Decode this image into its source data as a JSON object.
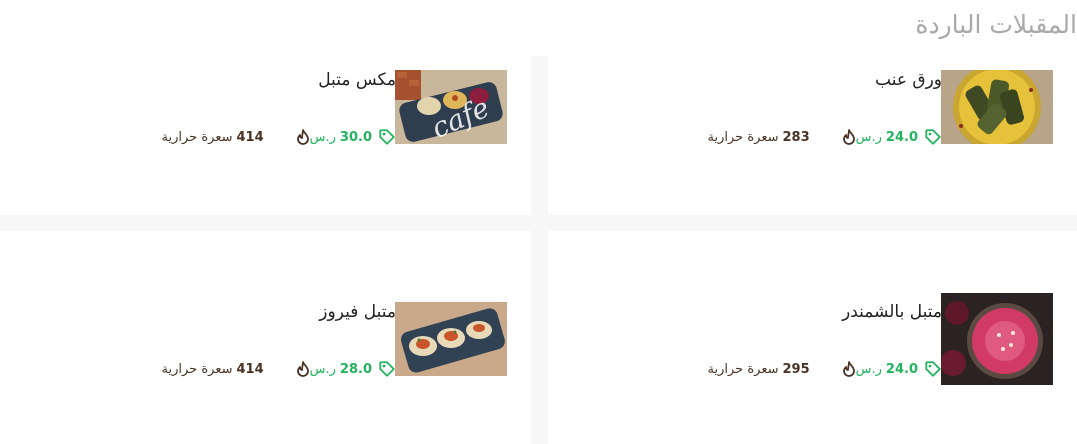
{
  "section": {
    "title": "المقبلات الباردة"
  },
  "items": [
    {
      "name": "ورق عنب",
      "price": "24.0",
      "currency": "ر.س",
      "calories": "283",
      "calories_label": "سعرة حرارية",
      "image": "stuffed-grape-leaves"
    },
    {
      "name": "مكس متبل",
      "price": "30.0",
      "currency": "ر.س",
      "calories": "414",
      "calories_label": "سعرة حرارية",
      "image": "mutabal-mix"
    },
    {
      "name": "متبل بالشمندر",
      "price": "24.0",
      "currency": "ر.س",
      "calories": "295",
      "calories_label": "سعرة حرارية",
      "image": "beetroot-mutabal"
    },
    {
      "name": "متبل فيروز",
      "price": "28.0",
      "currency": "ر.س",
      "calories": "414",
      "calories_label": "سعرة حرارية",
      "image": "fairouz-mutabal"
    }
  ],
  "watermark": "cafe",
  "colors": {
    "price": "#22b35e",
    "calories": "#4a3324",
    "title": "#a9a9a9",
    "gap": "#f7f7f7"
  },
  "icons": {
    "price": "tag-icon",
    "calories": "flame-icon"
  }
}
